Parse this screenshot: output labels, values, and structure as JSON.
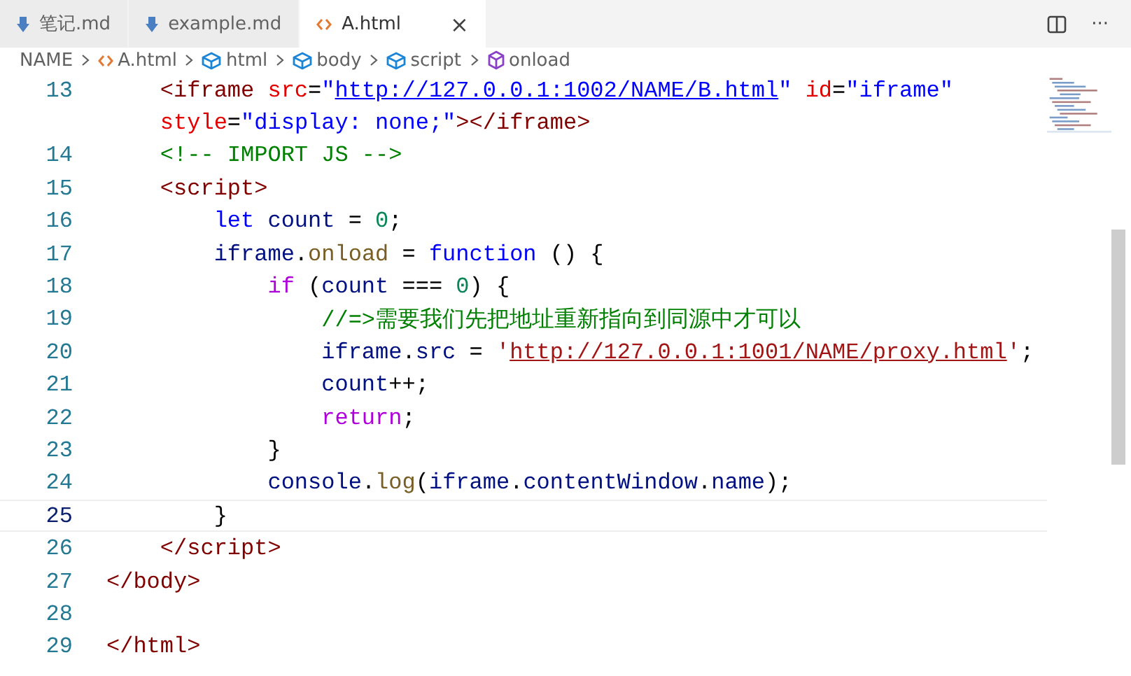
{
  "tabs": [
    {
      "label": "笔记.md",
      "kind": "markdown",
      "selected": false
    },
    {
      "label": "example.md",
      "kind": "markdown",
      "selected": false
    },
    {
      "label": "A.html",
      "kind": "html",
      "selected": true,
      "close": "×"
    }
  ],
  "editor_actions": {
    "more": "···"
  },
  "breadcrumb": [
    {
      "label": "NAME",
      "kind": "folder"
    },
    {
      "label": "A.html",
      "kind": "html"
    },
    {
      "label": "html",
      "kind": "element"
    },
    {
      "label": "body",
      "kind": "element"
    },
    {
      "label": "script",
      "kind": "element"
    },
    {
      "label": "onload",
      "kind": "method"
    }
  ],
  "lines": [
    {
      "number": "13",
      "current": false,
      "tokens": [
        {
          "kind": "tag",
          "text": "    <iframe"
        },
        {
          "kind": "attr",
          "text": " src"
        },
        {
          "kind": "plain",
          "text": "="
        },
        {
          "kind": "str",
          "text": "\""
        },
        {
          "kind": "link",
          "text": "http://127.0.0.1:1002/NAME/B.html"
        },
        {
          "kind": "str",
          "text": "\""
        },
        {
          "kind": "attr",
          "text": " id"
        },
        {
          "kind": "plain",
          "text": "="
        },
        {
          "kind": "str",
          "text": "\"iframe\""
        }
      ],
      "wrap": [
        {
          "kind": "attr",
          "text": "    style"
        },
        {
          "kind": "plain",
          "text": "="
        },
        {
          "kind": "str",
          "text": "\"display: none;\""
        },
        {
          "kind": "tag",
          "text": "></iframe>"
        }
      ]
    },
    {
      "number": "14",
      "current": false,
      "tokens": [
        {
          "kind": "comment",
          "text": "    <!-- IMPORT JS -->"
        }
      ]
    },
    {
      "number": "15",
      "current": false,
      "tokens": [
        {
          "kind": "tag",
          "text": "    <script>"
        }
      ]
    },
    {
      "number": "16",
      "current": false,
      "tokens": [
        {
          "kind": "keyword",
          "text": "        let"
        },
        {
          "kind": "var",
          "text": " count"
        },
        {
          "kind": "plain",
          "text": " = "
        },
        {
          "kind": "num",
          "text": "0"
        },
        {
          "kind": "plain",
          "text": ";"
        }
      ]
    },
    {
      "number": "17",
      "current": false,
      "tokens": [
        {
          "kind": "var",
          "text": "        iframe"
        },
        {
          "kind": "plain",
          "text": "."
        },
        {
          "kind": "func",
          "text": "onload"
        },
        {
          "kind": "plain",
          "text": " = "
        },
        {
          "kind": "keyword",
          "text": "function"
        },
        {
          "kind": "plain",
          "text": " () {"
        }
      ]
    },
    {
      "number": "18",
      "current": false,
      "tokens": [
        {
          "kind": "control",
          "text": "            if"
        },
        {
          "kind": "plain",
          "text": " ("
        },
        {
          "kind": "var",
          "text": "count"
        },
        {
          "kind": "plain",
          "text": " === "
        },
        {
          "kind": "num",
          "text": "0"
        },
        {
          "kind": "plain",
          "text": ") {"
        }
      ]
    },
    {
      "number": "19",
      "current": false,
      "tokens": [
        {
          "kind": "comment",
          "text": "                //=>需要我们先把地址重新指向到同源中才可以"
        }
      ]
    },
    {
      "number": "20",
      "current": false,
      "tokens": [
        {
          "kind": "var",
          "text": "                iframe"
        },
        {
          "kind": "plain",
          "text": "."
        },
        {
          "kind": "var",
          "text": "src"
        },
        {
          "kind": "plain",
          "text": " = "
        },
        {
          "kind": "sq",
          "text": "'"
        },
        {
          "kind": "strlink",
          "text": "http://127.0.0.1:1001/NAME/proxy.html"
        },
        {
          "kind": "sq",
          "text": "'"
        },
        {
          "kind": "plain",
          "text": ";"
        }
      ]
    },
    {
      "number": "21",
      "current": false,
      "tokens": [
        {
          "kind": "var",
          "text": "                count"
        },
        {
          "kind": "plain",
          "text": "++;"
        }
      ]
    },
    {
      "number": "22",
      "current": false,
      "tokens": [
        {
          "kind": "control",
          "text": "                return"
        },
        {
          "kind": "plain",
          "text": ";"
        }
      ]
    },
    {
      "number": "23",
      "current": false,
      "tokens": [
        {
          "kind": "plain",
          "text": "            }"
        }
      ]
    },
    {
      "number": "24",
      "current": false,
      "tokens": [
        {
          "kind": "var",
          "text": "            console"
        },
        {
          "kind": "plain",
          "text": "."
        },
        {
          "kind": "func",
          "text": "log"
        },
        {
          "kind": "plain",
          "text": "("
        },
        {
          "kind": "var",
          "text": "iframe"
        },
        {
          "kind": "plain",
          "text": "."
        },
        {
          "kind": "var",
          "text": "contentWindow"
        },
        {
          "kind": "plain",
          "text": "."
        },
        {
          "kind": "var",
          "text": "name"
        },
        {
          "kind": "plain",
          "text": ");"
        }
      ]
    },
    {
      "number": "25",
      "current": true,
      "tokens": [
        {
          "kind": "plain",
          "text": "        }"
        }
      ]
    },
    {
      "number": "26",
      "current": false,
      "tokens": [
        {
          "kind": "tag",
          "text": "    </script>"
        }
      ]
    },
    {
      "number": "27",
      "current": false,
      "tokens": [
        {
          "kind": "tag",
          "text": "</body>"
        }
      ]
    },
    {
      "number": "28",
      "current": false
    },
    {
      "number": "29",
      "current": false,
      "tokens": [
        {
          "kind": "tag",
          "text": "</html>"
        }
      ]
    }
  ]
}
